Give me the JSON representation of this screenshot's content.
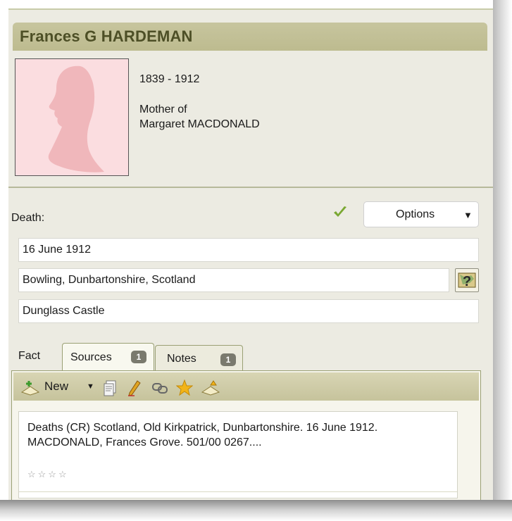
{
  "person": {
    "name": "Frances G HARDEMAN",
    "dates": "1839 - 1912",
    "relation_line1": "Mother of",
    "relation_line2": "Margaret MACDONALD"
  },
  "event": {
    "label": "Death:",
    "options_label": "Options",
    "date": "16 June 1912",
    "place": "Bowling, Dunbartonshire, Scotland",
    "description": "Dunglass Castle"
  },
  "tabs": {
    "fact": "Fact",
    "sources": {
      "label": "Sources",
      "count": "1"
    },
    "notes": {
      "label": "Notes",
      "count": "1"
    }
  },
  "toolbar": {
    "new_label": "New"
  },
  "source": {
    "citation": "Deaths (CR) Scotland, Old Kirkpatrick, Dunbartonshire. 16 June 1912. MACDONALD, Frances Grove. 501/00 0267....",
    "rating": "☆☆☆☆"
  },
  "colors": {
    "header_bg": "#c7c59e",
    "header_text": "#4d4f26",
    "panel_bg": "#ecebe2",
    "photo_bg": "#fbdde0",
    "check_green": "#7aa832",
    "star_gold": "#f2b418"
  },
  "icons": [
    "check-icon",
    "help-map-icon",
    "new-source-icon",
    "dropdown-icon",
    "document-icon",
    "pencil-icon",
    "link-icon",
    "star-icon",
    "source-add-icon",
    "silhouette-icon"
  ]
}
